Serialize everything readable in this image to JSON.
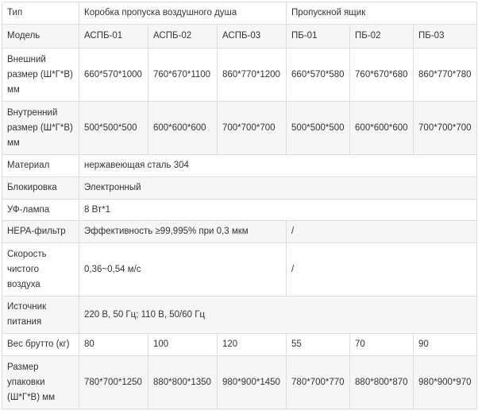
{
  "table": {
    "header": {
      "type_label": "Тип",
      "group_air": "Коробка пропуска воздушного душа",
      "group_box": "Пропускной ящик"
    },
    "rows": {
      "model": {
        "label": "Модель",
        "values": [
          "АСПБ-01",
          "АСПБ-02",
          "АСПБ-03",
          "ПБ-01",
          "ПБ-02",
          "ПБ-03"
        ]
      },
      "outer": {
        "label": [
          "Внешний",
          "размер (Ш*Г*В)",
          "мм"
        ],
        "values": [
          "660*570*1000",
          "760*670*1100",
          "860*770*1200",
          "660*570*580",
          "760*670*680",
          "860*770*780"
        ]
      },
      "inner": {
        "label": [
          "Внутренний",
          "размер (Ш*Г*В)",
          "мм"
        ],
        "values": [
          "500*500*500",
          "600*600*600",
          "700*700*700",
          "500*500*500",
          "600*600*600",
          "700*700*700"
        ]
      },
      "material": {
        "label": "Материал",
        "value": "нержавеющая сталь 304"
      },
      "lock": {
        "label": "Блокировка",
        "value": "Электронный"
      },
      "uv": {
        "label": "УФ-лампа",
        "value": "8 Вт*1"
      },
      "hepa": {
        "label": "HEPA-фильтр",
        "value_air": "Эффективность ≥99,995% при 0,3 мкм",
        "value_box": "/"
      },
      "speed": {
        "label": [
          "Скорость",
          "чистого",
          "воздуха"
        ],
        "value_air": "0,36~0,54 м/с",
        "value_box": "/"
      },
      "power": {
        "label": [
          "Источник",
          "питания"
        ],
        "value": "220 В, 50 Гц; 110 В, 50/60 Гц"
      },
      "weight": {
        "label": "Вес брутто (кг)",
        "values": [
          "80",
          "100",
          "120",
          "55",
          "70",
          "90"
        ]
      },
      "pack": {
        "label": [
          "Размер",
          "упаковки",
          "(Ш*Г*В) мм"
        ],
        "values": [
          "780*700*1250",
          "880*800*1350",
          "980*900*1450",
          "780*700*770",
          "880*800*870",
          "980*900*970"
        ]
      }
    }
  }
}
